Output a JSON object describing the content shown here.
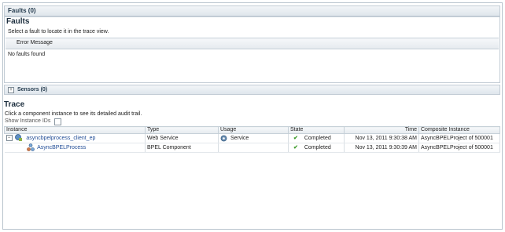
{
  "faults_panel": {
    "header": "Faults (0)",
    "title": "Faults",
    "instruction": "Select a fault to locate it in the trace view.",
    "column": "Error Message",
    "empty_text": "No faults found"
  },
  "sensors_panel": {
    "header": "Sensors (0)",
    "expander": "+"
  },
  "trace": {
    "title": "Trace",
    "instruction": "Click a component instance to see its detailed audit trail.",
    "show_ids_label": "Show Instance IDs",
    "columns": {
      "instance": "Instance",
      "type": "Type",
      "usage": "Usage",
      "state": "State",
      "time": "Time",
      "composite": "Composite Instance"
    },
    "rows": [
      {
        "instance": "asyncbpelprocess_client_ep",
        "type": "Web Service",
        "usage": "Service",
        "state": "Completed",
        "time": "Nov 13, 2011 9:30:38 AM",
        "composite": "AsyncBPELProject of 500001"
      },
      {
        "instance": "AsyncBPELProcess",
        "type": "BPEL Component",
        "usage": "",
        "state": "Completed",
        "time": "Nov 13, 2011 9:30:39 AM",
        "composite": "AsyncBPELProject of 500001"
      }
    ]
  },
  "colors": {
    "link": "#1f4b95",
    "check": "#3c9a2a",
    "header_text": "#243b4e"
  }
}
